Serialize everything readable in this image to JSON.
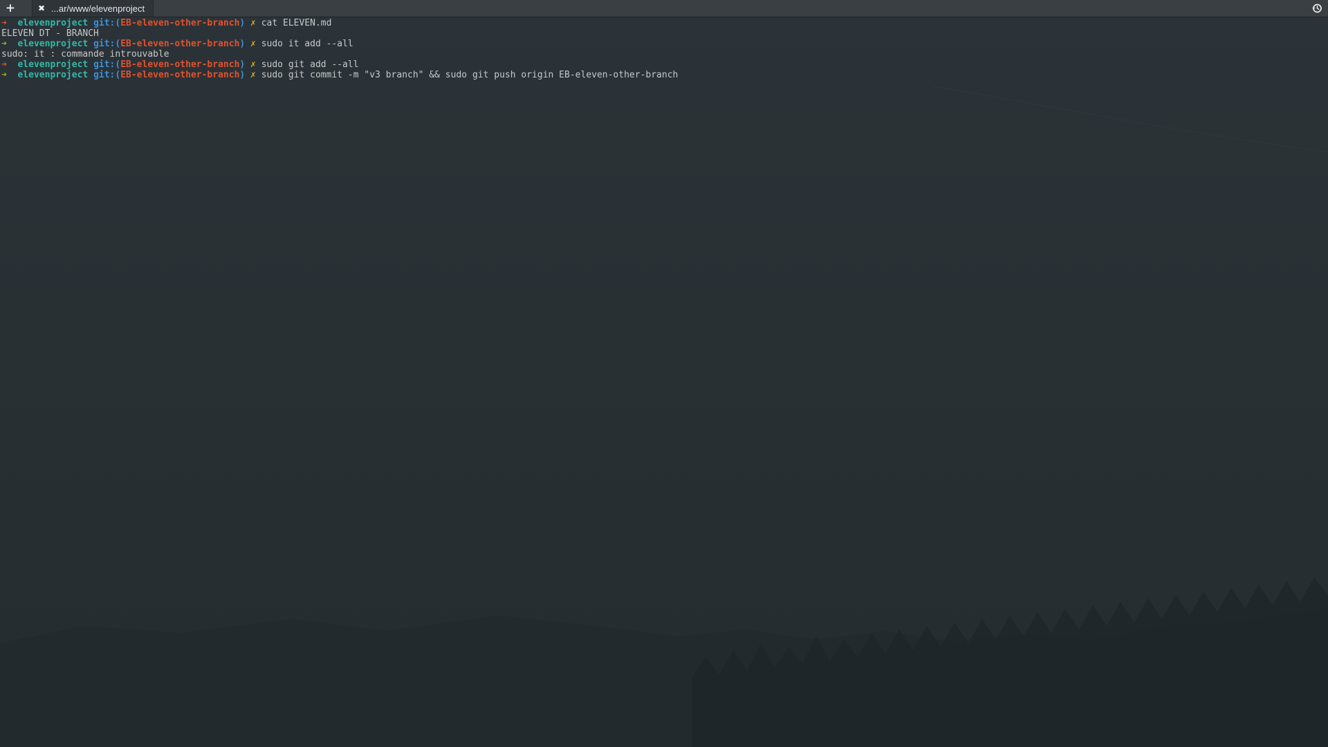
{
  "tabbar": {
    "new_tab_glyph": "+",
    "tab": {
      "close_glyph": "✖",
      "title": "...ar/www/elevenproject"
    },
    "history_icon": "history-icon"
  },
  "terminal": {
    "prompt": {
      "arrow": "➜",
      "dir": "elevenproject",
      "git_label": "git:(",
      "branch": "EB-eleven-other-branch",
      "paren_close": ")",
      "dirty_marker": "✗"
    },
    "lines": [
      {
        "type": "prompt",
        "arrow_color": "red",
        "command": "cat ELEVEN.md"
      },
      {
        "type": "output",
        "text": "ELEVEN DT - BRANCH"
      },
      {
        "type": "prompt",
        "arrow_color": "green",
        "command": "sudo it add --all"
      },
      {
        "type": "output",
        "text": "sudo: it : commande introuvable"
      },
      {
        "type": "prompt",
        "arrow_color": "red",
        "command": "sudo git add --all"
      },
      {
        "type": "prompt",
        "arrow_color": "green",
        "command": "sudo git commit -m \"v3 branch\" && sudo git push origin EB-eleven-other-branch"
      }
    ]
  },
  "colors": {
    "background": "#262d31",
    "tabbar": "#3a3f43",
    "arrow_red": "#e0522c",
    "arrow_green": "#8ab81e",
    "dir": "#34b8a8",
    "git": "#3c8fd8",
    "branch": "#e0522c",
    "dirty": "#d8b020",
    "text": "#c8c8c8"
  }
}
